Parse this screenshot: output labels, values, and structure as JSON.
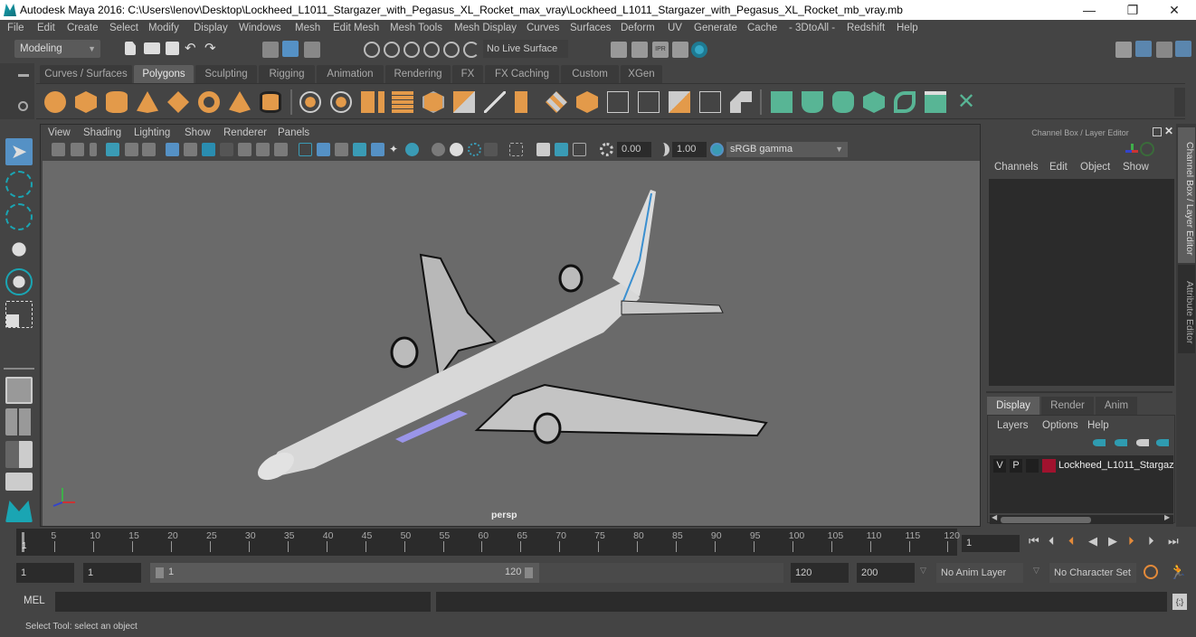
{
  "window": {
    "title": "Autodesk Maya 2016: C:\\Users\\lenov\\Desktop\\Lockheed_L1011_Stargazer_with_Pegasus_XL_Rocket_max_vray\\Lockheed_L1011_Stargazer_with_Pegasus_XL_Rocket_mb_vray.mb",
    "minimize": "—",
    "maximize": "❐",
    "close": "✕"
  },
  "menu": [
    "File",
    "Edit",
    "Create",
    "Select",
    "Modify",
    "Display",
    "Windows",
    "Mesh",
    "Edit Mesh",
    "Mesh Tools",
    "Mesh Display",
    "Curves",
    "Surfaces",
    "Deform",
    "UV",
    "Generate",
    "Cache",
    "- 3DtoAll -",
    "Redshift",
    "Help"
  ],
  "status_line": {
    "menuset": "Modeling",
    "live_surface": "No Live Surface"
  },
  "shelf": {
    "tabs": [
      "Curves / Surfaces",
      "Polygons",
      "Sculpting",
      "Rigging",
      "Animation",
      "Rendering",
      "FX",
      "FX Caching",
      "Custom",
      "XGen"
    ],
    "active_tab": "Polygons",
    "orange_icons": [
      "poly-sphere-icon",
      "poly-cube-icon",
      "poly-cylinder-icon",
      "poly-cone-icon",
      "poly-plane-icon",
      "poly-torus-icon",
      "poly-pyramid-icon",
      "poly-pipe-icon"
    ],
    "tool_icons": [
      "combine-icon",
      "separate-icon",
      "mirror-icon",
      "smooth-icon",
      "bevel-icon",
      "extrude-icon",
      "multicut-icon",
      "bridge-icon",
      "append-icon",
      "merge-icon",
      "insert-loop-icon",
      "offset-loop-icon",
      "fill-hole-icon",
      "target-weld-icon",
      "collapse-icon",
      "boolean-icon"
    ],
    "uv_icons": [
      "planar-map-icon",
      "cylindrical-map-icon",
      "spherical-map-icon",
      "automatic-map-icon",
      "contour-stretch-icon",
      "uv-editor-icon",
      "unfold-icon"
    ]
  },
  "viewport": {
    "menu": [
      "View",
      "Shading",
      "Lighting",
      "Show",
      "Renderer",
      "Panels"
    ],
    "exposure": "0.00",
    "gamma": "1.00",
    "color_space": "sRGB gamma",
    "camera_label": "persp"
  },
  "channel_box": {
    "title": "Channel Box / Layer Editor",
    "menu": [
      "Channels",
      "Edit",
      "Object",
      "Show"
    ]
  },
  "layer_editor": {
    "tabs": [
      "Display",
      "Render",
      "Anim"
    ],
    "active_tab": "Display",
    "menu": [
      "Layers",
      "Options",
      "Help"
    ],
    "layers": [
      {
        "visible": "V",
        "playback": "P",
        "color": "#a0122e",
        "name": "Lockheed_L1011_Stargaz"
      }
    ]
  },
  "side_tabs": [
    "Channel Box / Layer Editor",
    "Attribute Editor"
  ],
  "timeline": {
    "ticks": [
      5,
      10,
      15,
      20,
      25,
      30,
      35,
      40,
      45,
      50,
      55,
      60,
      65,
      70,
      75,
      80,
      85,
      90,
      95,
      100,
      105,
      110,
      115,
      120
    ],
    "current_frame_marker": "1",
    "current_frame": "1"
  },
  "range": {
    "start_time": "1",
    "playback_start": "1",
    "slider_start": "1",
    "slider_end": "120",
    "playback_end": "120",
    "end_time": "200",
    "anim_layer": "No Anim Layer",
    "character_set": "No Character Set"
  },
  "command_line": {
    "label": "MEL"
  },
  "status": "Select Tool: select an object"
}
